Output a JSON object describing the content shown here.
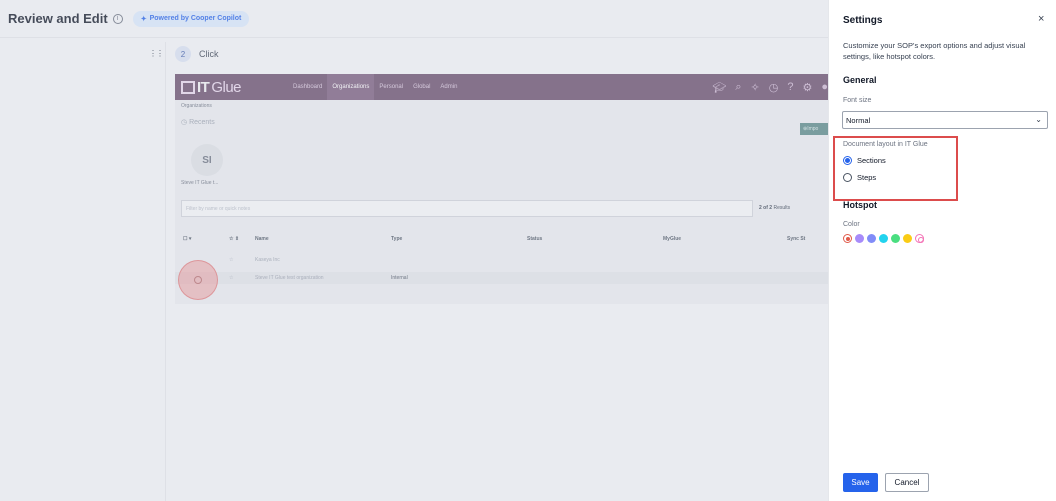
{
  "header": {
    "title": "Review and Edit",
    "copilot_badge": "Powered by Cooper Copilot"
  },
  "step": {
    "number": "2",
    "label": "Click"
  },
  "screenshot": {
    "logo_bold": "IT",
    "logo_light": "Glue",
    "nav": [
      "Dashboard",
      "Organizations",
      "Personal",
      "Global",
      "Admin"
    ],
    "breadcrumb": "Organizations",
    "recents": "Recents",
    "import_label": "Impo",
    "avatar_initials": "SI",
    "avatar_label": "Steve IT Glue t...",
    "filter_placeholder": "Filter by name or quick notes",
    "results_count": "2 of 2",
    "results_label": "Results",
    "columns": [
      "Name",
      "Type",
      "Status",
      "MyGlue",
      "Sync St"
    ],
    "rows": [
      {
        "name": "Kaseya Inc",
        "type": ""
      },
      {
        "name": "Steve IT Glue test organization",
        "type": "Internal"
      }
    ]
  },
  "settings": {
    "title": "Settings",
    "close": "×",
    "description": "Customize your SOP's export options and adjust visual settings, like hotspot colors.",
    "general_heading": "General",
    "font_size_label": "Font size",
    "font_size_value": "Normal",
    "layout_label": "Document layout in IT Glue",
    "layout_options": [
      "Sections",
      "Steps"
    ],
    "layout_selected": "Sections",
    "hotspot_heading": "Hotspot",
    "color_label": "Color",
    "colors": [
      "#e05a4a",
      "#a78bfa",
      "#818cf8",
      "#22d3ee",
      "#4ade80",
      "#facc15",
      "#f472b6"
    ],
    "save_label": "Save",
    "cancel_label": "Cancel"
  }
}
